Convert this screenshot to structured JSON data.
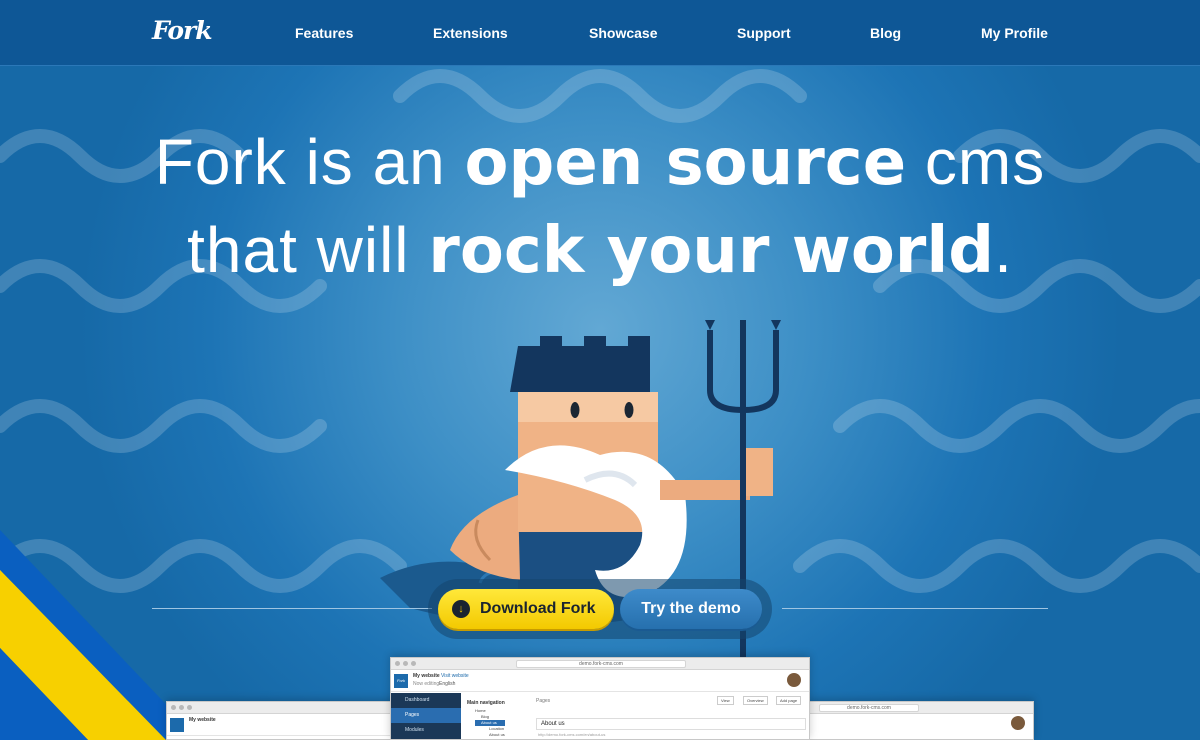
{
  "brand": {
    "logo_text": "Fork"
  },
  "nav": {
    "items": [
      "Features",
      "Extensions",
      "Showcase",
      "Support",
      "Blog",
      "My Profile"
    ]
  },
  "hero": {
    "line1_thin_a": "Fork is an ",
    "line1_bold": "open source",
    "line1_thin_b": " cms",
    "line2_thin": "that will ",
    "line2_bold": "rock your world",
    "line2_period": "."
  },
  "cta": {
    "download_label": "Download Fork",
    "download_icon": "download-icon",
    "demo_label": "Try the demo"
  },
  "preview": {
    "url": "demo.fork-cms.com",
    "site_title": "My website",
    "visit_link": "Visit website",
    "editing_label": "Now editing:",
    "language": "English",
    "sidebar": [
      "Dashboard",
      "Pages",
      "Modules"
    ],
    "tree_title": "Main navigation",
    "tree_items": [
      "Home",
      "Blog",
      "About us",
      "Location",
      "About us"
    ],
    "pages_label": "Pages",
    "view_btn": "View",
    "overview_btn": "Overview",
    "add_page_btn": "Add page",
    "page_title_value": "About us",
    "page_url": "http://demo.fork-cms.com/en/about-us"
  },
  "colors": {
    "nav_bg": "#0e5796",
    "hero_blue": "#1d74b5",
    "download_yellow": "#f3c900",
    "demo_blue": "#2670ae",
    "stripe_yellow": "#f7d000",
    "stripe_blue": "#0a5fc0"
  }
}
